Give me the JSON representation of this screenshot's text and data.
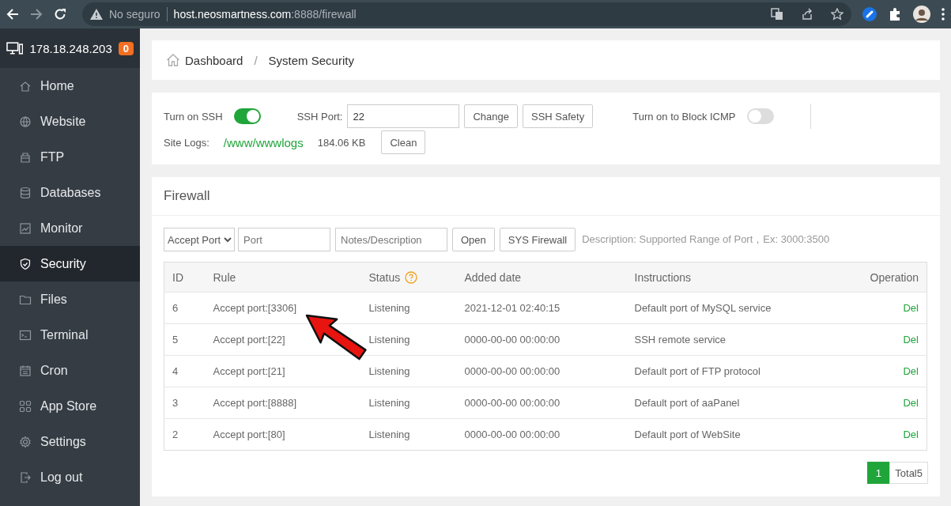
{
  "browser": {
    "forward_disabled": true,
    "security_label": "No seguro",
    "url_host": "host.neosmartness.com",
    "url_path": ":8888/firewall"
  },
  "sidebar": {
    "server": "178.18.248.203",
    "badge": "0",
    "items": [
      {
        "label": "Home",
        "selected": false
      },
      {
        "label": "Website",
        "selected": false
      },
      {
        "label": "FTP",
        "selected": false
      },
      {
        "label": "Databases",
        "selected": false
      },
      {
        "label": "Monitor",
        "selected": false
      },
      {
        "label": "Security",
        "selected": true
      },
      {
        "label": "Files",
        "selected": false
      },
      {
        "label": "Terminal",
        "selected": false
      },
      {
        "label": "Cron",
        "selected": false
      },
      {
        "label": "App Store",
        "selected": false
      },
      {
        "label": "Settings",
        "selected": false
      },
      {
        "label": "Log out",
        "selected": false
      }
    ]
  },
  "breadcrumb": {
    "separator": "/",
    "items": [
      "Dashboard",
      "System Security"
    ]
  },
  "ssh": {
    "ssh_label": "Turn on SSH",
    "ssh_on": true,
    "port_label": "SSH Port:",
    "port_value": "22",
    "buttons": [
      "Change",
      "SSH Safety"
    ],
    "icmp_label": "Turn on to Block ICMP",
    "icmp_on": false,
    "logs_label": "Site Logs:",
    "logs_path": "/www/wwwlogs",
    "logs_size": "184.06 KB",
    "clean_button": "Clean"
  },
  "firewall": {
    "title": "Firewall",
    "type_select": "Accept Port",
    "port_placeholder": "Port",
    "notes_placeholder": "Notes/Description",
    "buttons": [
      "Open",
      "SYS Firewall"
    ],
    "description": "Description: Supported Range of Port，Ex: 3000:3500",
    "columns": [
      "ID",
      "Rule",
      "Status",
      "Added date",
      "Instructions",
      "Operation"
    ],
    "rows": [
      {
        "id": "6",
        "rule": "Accept port:[3306]",
        "status": "Listening",
        "added": "2021-12-01 02:40:15",
        "instructions": "Default port of MySQL service",
        "action": "Del"
      },
      {
        "id": "5",
        "rule": "Accept port:[22]",
        "status": "Listening",
        "added": "0000-00-00 00:00:00",
        "instructions": "SSH remote service",
        "action": "Del"
      },
      {
        "id": "4",
        "rule": "Accept port:[21]",
        "status": "Listening",
        "added": "0000-00-00 00:00:00",
        "instructions": "Default port of FTP protocol",
        "action": "Del"
      },
      {
        "id": "3",
        "rule": "Accept port:[8888]",
        "status": "Listening",
        "added": "0000-00-00 00:00:00",
        "instructions": "Default port of aaPanel",
        "action": "Del"
      },
      {
        "id": "2",
        "rule": "Accept port:[80]",
        "status": "Listening",
        "added": "0000-00-00 00:00:00",
        "instructions": "Default port of WebSite",
        "action": "Del"
      }
    ],
    "pagination": {
      "pages": [
        {
          "label": "1",
          "selected": true
        }
      ],
      "total": "Total5"
    }
  }
}
